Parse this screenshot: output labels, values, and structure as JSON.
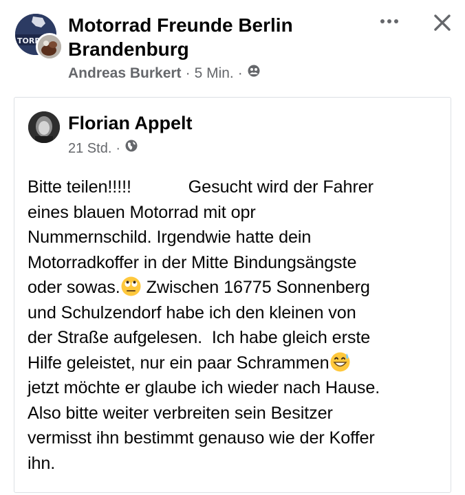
{
  "group": {
    "title": "Motorrad Freunde Berlin Brandenburg",
    "author": "Andreas Burkert",
    "separator": "·",
    "time": "5 Min.",
    "audience_icon": "group-members-icon",
    "avatar_text": "TORR",
    "more_icon": "more-options-icon",
    "close_icon": "close-icon"
  },
  "shared_post": {
    "author": "Florian Appelt",
    "separator": "·",
    "time": "21 Std.",
    "audience_icon": "globe-icon",
    "body": {
      "part1": "Bitte teilen!!!!!            Gesucht wird der Fahrer\neines blauen Motorrad mit opr\nNummernschild. Irgendwie hatte dein\nMotorradkoffer in der Mitte Bindungsängste\noder sowas.",
      "emoji1": "eye-roll-emoji-icon",
      "part2": " Zwischen 16775 Sonnenberg\nund Schulzendorf habe ich den kleinen von\nder Straße aufgelesen.  Ich habe gleich erste\nHilfe geleistet, nur ein paar Schrammen",
      "emoji2": "grinning-sweat-emoji-icon",
      "part3": "\njetzt möchte er glaube ich wieder nach Hause.\nAlso bitte weiter verbreiten sein Besitzer\nvermisst ihn bestimmt genauso wie der Koffer\nihn."
    }
  },
  "colors": {
    "text": "#050505",
    "secondary": "#65676b",
    "border": "#dcdfe4"
  }
}
